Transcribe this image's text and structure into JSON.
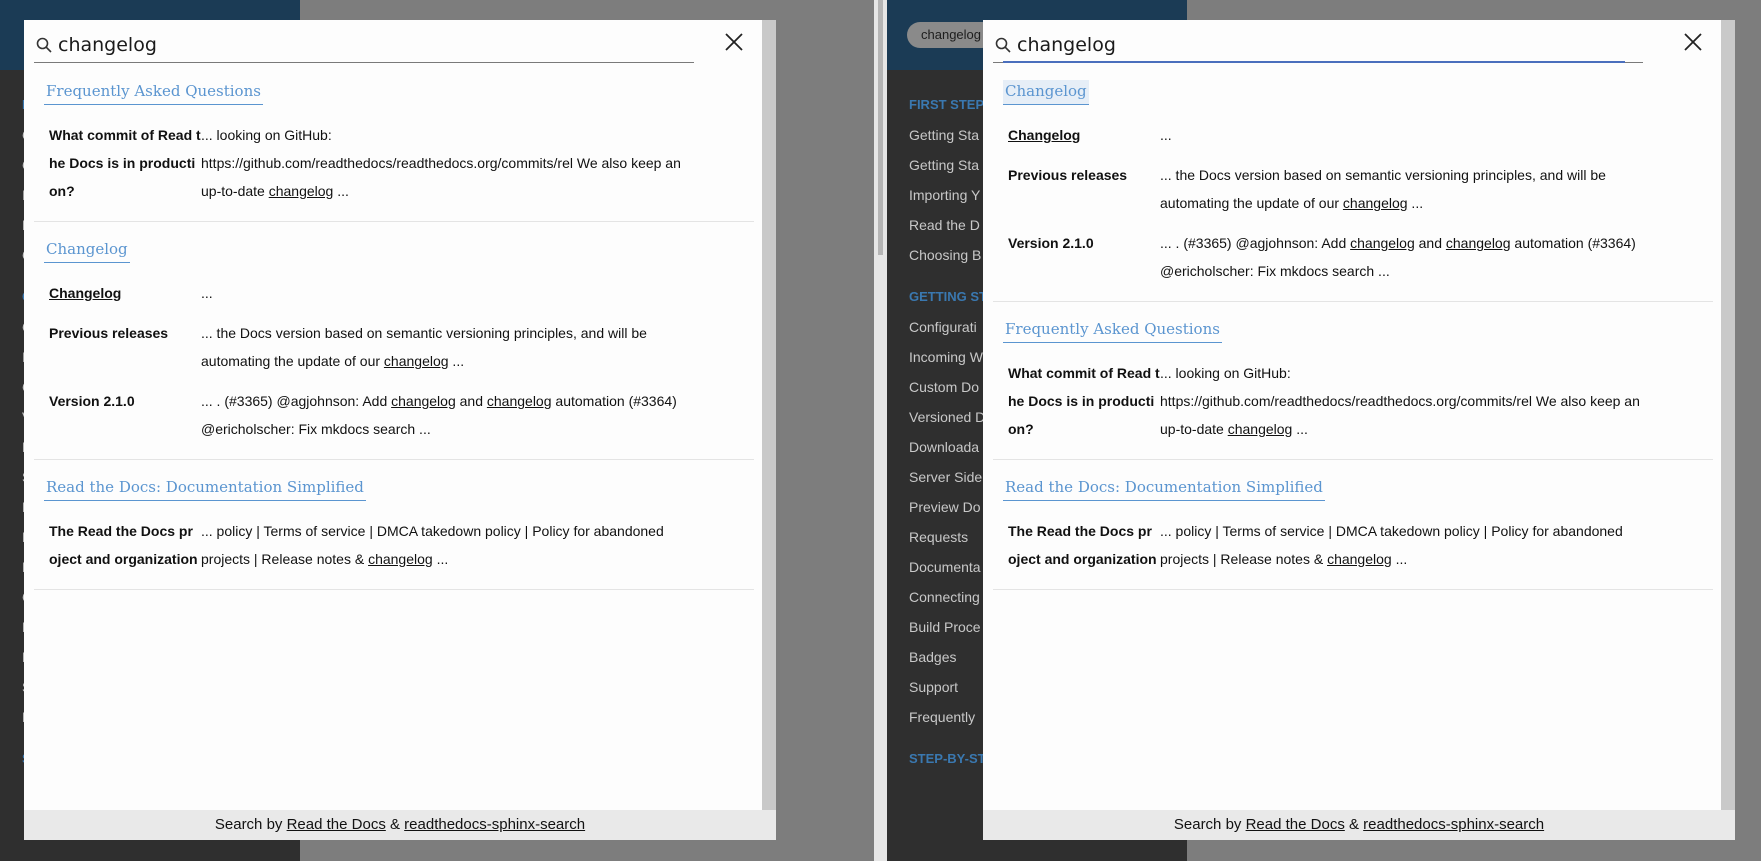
{
  "background": {
    "left_nav": [
      "Getting Sta",
      "Getting Sta",
      "Importing Y",
      "Read the D",
      "Choosing B",
      "Configurati",
      "Incoming W",
      "Custom Do",
      "Versioned D",
      "Downloada",
      "Server Side",
      "Preview Do",
      "Requests",
      "Documenta",
      "Connecting",
      "Build Proce",
      "Badges",
      "Support",
      "Frequently"
    ],
    "chip": "changelog",
    "nav_caption_1": "FIRST STEPS",
    "nav_caption_2": "GETTING ST",
    "nav_caption_3": "STEP-BY-ST"
  },
  "search": {
    "query": "changelog",
    "close_label": "×"
  },
  "panels": {
    "left": {
      "sections": [
        {
          "title": "Frequently Asked Questions",
          "rows": [
            {
              "name": "What commit of Read the Docs is in production?",
              "pre": "... looking on GitHub: https://github.com/readthedocs/readthedocs.org/commits/rel We also keep an up-to-date ",
              "hl1": "changelog",
              "mid": " ...",
              "hl2": "",
              "post": ""
            }
          ]
        },
        {
          "title": "Changelog",
          "rows": [
            {
              "name": "Changelog",
              "name_link": true,
              "pre": "...",
              "hl1": "",
              "mid": "",
              "hl2": "",
              "post": ""
            },
            {
              "name": "Previous releases",
              "pre": "... the Docs version based on semantic versioning principles, and will be automating the update of our ",
              "hl1": "changelog",
              "mid": " ...",
              "hl2": "",
              "post": ""
            },
            {
              "name": "Version 2.1.0",
              "pre": "... . (#3365) @agjohnson: Add ",
              "hl1": "changelog",
              "mid": " and ",
              "hl2": "changelog",
              "post": " automation (#3364) @ericholscher: Fix mkdocs search ..."
            }
          ]
        },
        {
          "title": "Read the Docs: Documentation Simplified",
          "rows": [
            {
              "name": "The Read the Docs project and organization",
              "pre": "... policy | Terms of service | DMCA takedown policy | Policy for abandoned projects | Release notes & ",
              "hl1": "changelog",
              "mid": " ...",
              "hl2": "",
              "post": ""
            }
          ]
        }
      ]
    },
    "right": {
      "sections": [
        {
          "title": "Changelog",
          "rows": [
            {
              "name": "Changelog",
              "name_link": true,
              "pre": "...",
              "hl1": "",
              "mid": "",
              "hl2": "",
              "post": ""
            },
            {
              "name": "Previous releases",
              "pre": "... the Docs version based on semantic versioning principles, and will be automating the update of our ",
              "hl1": "changelog",
              "mid": " ...",
              "hl2": "",
              "post": ""
            },
            {
              "name": "Version 2.1.0",
              "pre": "... . (#3365) @agjohnson: Add ",
              "hl1": "changelog",
              "mid": " and ",
              "hl2": "changelog",
              "post": " automation (#3364) @ericholscher: Fix mkdocs search ..."
            }
          ]
        },
        {
          "title": "Frequently Asked Questions",
          "rows": [
            {
              "name": "What commit of Read the Docs is in production?",
              "pre": "... looking on GitHub: https://github.com/readthedocs/readthedocs.org/commits/rel We also keep an up-to-date ",
              "hl1": "changelog",
              "mid": " ...",
              "hl2": "",
              "post": ""
            }
          ]
        },
        {
          "title": "Read the Docs: Documentation Simplified",
          "rows": [
            {
              "name": "The Read the Docs project and organization",
              "pre": "... policy | Terms of service | DMCA takedown policy | Policy for abandoned projects | Release notes & ",
              "hl1": "changelog",
              "mid": " ...",
              "hl2": "",
              "post": ""
            }
          ]
        }
      ]
    }
  },
  "footer": {
    "prefix": "Search by ",
    "link1": "Read the Docs",
    "amp": " & ",
    "link2": "readthedocs-sphinx-search"
  },
  "colors": {
    "accent": "#5b95d0",
    "focus": "#4b6fbd"
  }
}
